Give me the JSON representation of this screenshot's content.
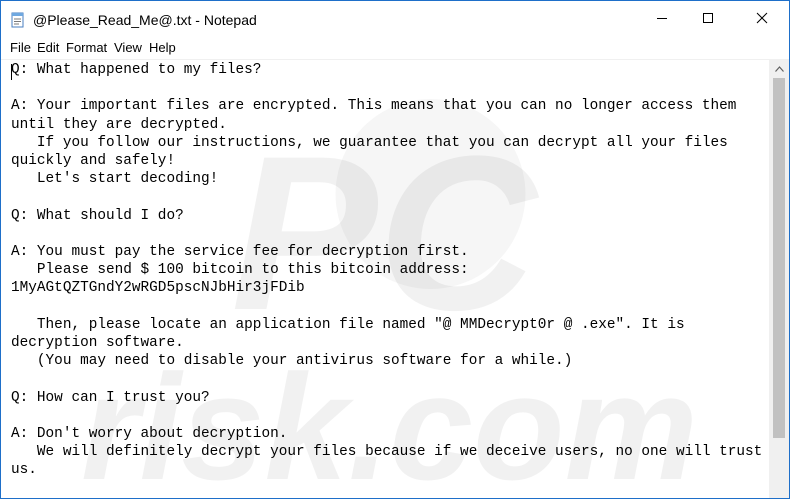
{
  "window": {
    "title": "@Please_Read_Me@.txt - Notepad"
  },
  "menu": {
    "file": "File",
    "edit": "Edit",
    "format": "Format",
    "view": "View",
    "help": "Help"
  },
  "icons": {
    "app": "notepad-icon",
    "minimize": "minimize-icon",
    "maximize": "maximize-icon",
    "close": "close-icon",
    "scroll_up": "scroll-up-arrow-icon"
  },
  "document": {
    "text": "Q: What happened to my files?\n\nA: Your important files are encrypted. This means that you can no longer access them\nuntil they are decrypted.\n   If you follow our instructions, we guarantee that you can decrypt all your files\nquickly and safely!\n   Let's start decoding!\n\nQ: What should I do?\n\nA: You must pay the service fee for decryption first.\n   Please send $ 100 bitcoin to this bitcoin address:\n1MyAGtQZTGndY2wRGD5pscNJbHir3jFDib\n\n   Then, please locate an application file named \"@ MMDecrypt0r @ .exe\". It is\ndecryption software.\n   (You may need to disable your antivirus software for a while.)\n\nQ: How can I trust you?\n\nA: Don't worry about decryption.\n   We will definitely decrypt your files because if we deceive users, no one will trust\nus."
  },
  "colors": {
    "window_border": "#1e6fc9",
    "scrollbar_track": "#f0f0f0",
    "scrollbar_thumb": "#c1c1c1",
    "watermark": "#d9d9d9"
  }
}
